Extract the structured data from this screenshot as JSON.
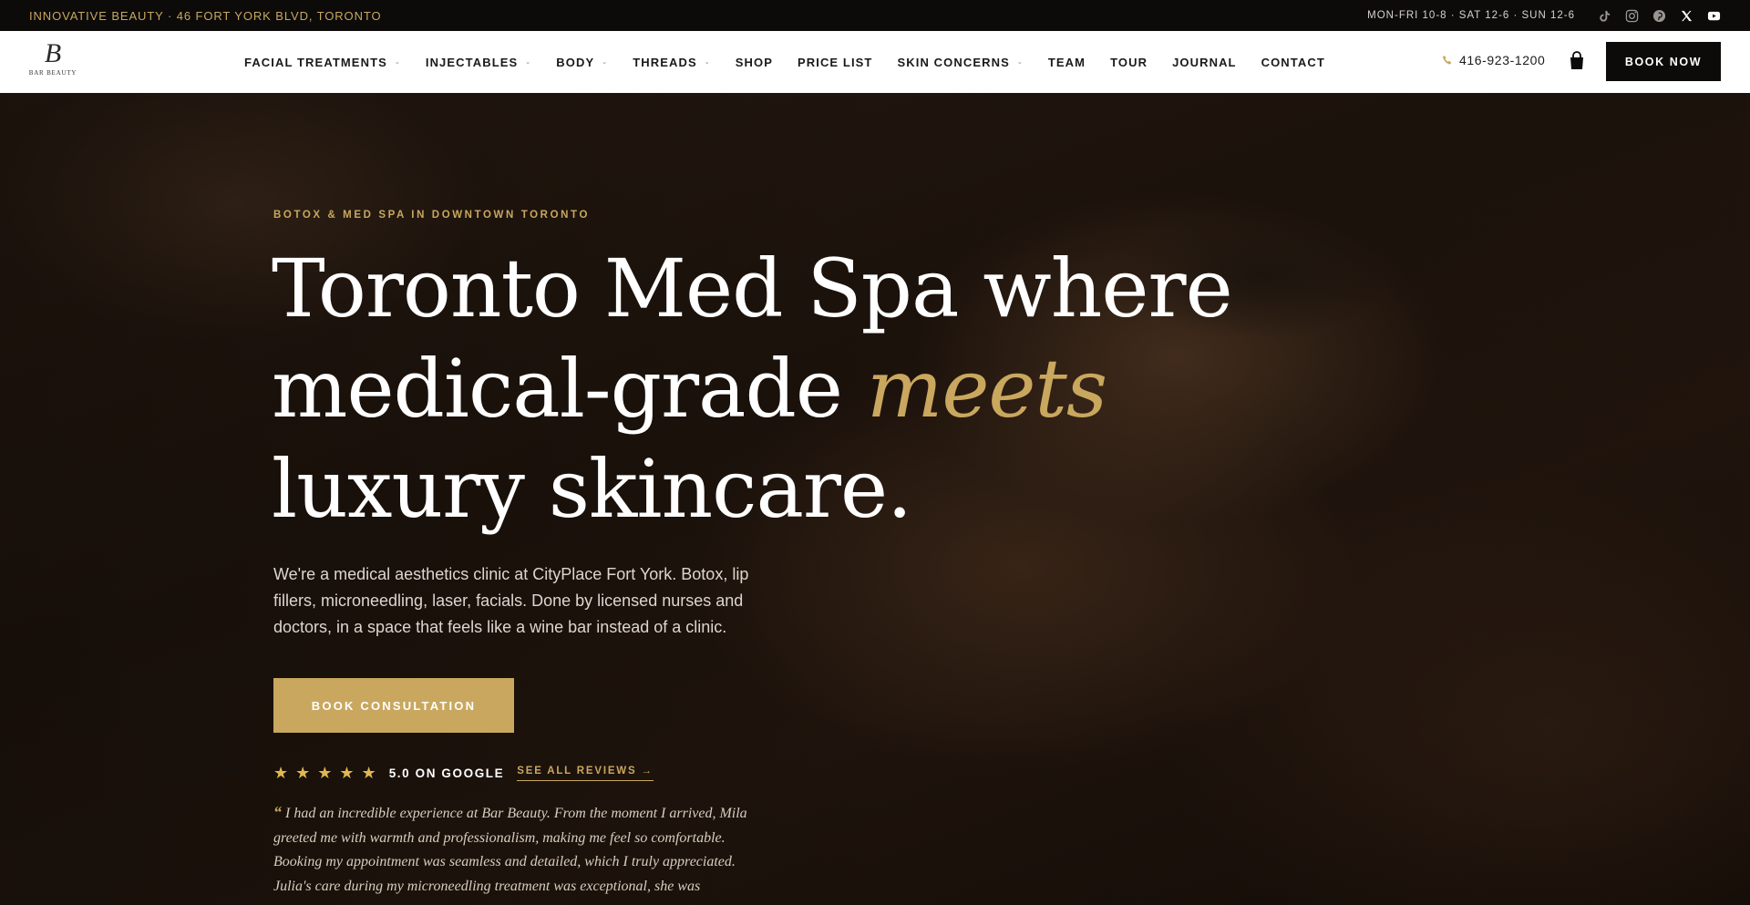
{
  "topbar": {
    "address": "INNOVATIVE BEAUTY · 46 FORT YORK BLVD, TORONTO",
    "hours": "MON-FRI 10-8 · SAT 12-6 · SUN 12-6",
    "social": [
      "tiktok-icon",
      "instagram-icon",
      "pinterest-icon",
      "x-icon",
      "youtube-icon"
    ]
  },
  "nav": {
    "logo_text": "BAR BEAUTY",
    "items": [
      {
        "label": "FACIAL TREATMENTS",
        "has_dropdown": true
      },
      {
        "label": "INJECTABLES",
        "has_dropdown": true
      },
      {
        "label": "BODY",
        "has_dropdown": true
      },
      {
        "label": "THREADS",
        "has_dropdown": true
      },
      {
        "label": "SHOP",
        "has_dropdown": false
      },
      {
        "label": "PRICE LIST",
        "has_dropdown": false
      },
      {
        "label": "SKIN CONCERNS",
        "has_dropdown": true
      },
      {
        "label": "TEAM",
        "has_dropdown": false
      },
      {
        "label": "TOUR",
        "has_dropdown": false
      },
      {
        "label": "JOURNAL",
        "has_dropdown": false
      },
      {
        "label": "CONTACT",
        "has_dropdown": false
      }
    ],
    "caret": "⌄",
    "phone": "416-923-1200",
    "book_now": "BOOK NOW"
  },
  "hero": {
    "eyebrow": "BOTOX & MED SPA IN DOWNTOWN TORONTO",
    "headline_part1": "Toronto Med Spa where medical-grade ",
    "headline_accent": "meets",
    "headline_part2": " luxury skincare.",
    "subtext": "We're a medical aesthetics clinic at CityPlace Fort York. Botox, lip fillers, microneedling, laser, facials. Done by licensed nurses and doctors, in a space that feels like a wine bar instead of a clinic.",
    "cta": "BOOK CONSULTATION",
    "stars": "★★★★★",
    "rating": "5.0 ON GOOGLE",
    "see_all": "SEE ALL REVIEWS →",
    "quote_open": "“",
    "quote": " I had an incredible experience at Bar Beauty. From the moment I arrived, Mila greeted me with warmth and professionalism, making me feel so comfortable. Booking my appointment was seamless and detailed, which I truly appreciated. Julia's care during my microneedling treatment was exceptional, she was attentive, know... ",
    "quote_close": "”"
  },
  "colors": {
    "accent_gold": "#c9a75e",
    "dark": "#0c0b0a",
    "star": "#e0b84f"
  }
}
